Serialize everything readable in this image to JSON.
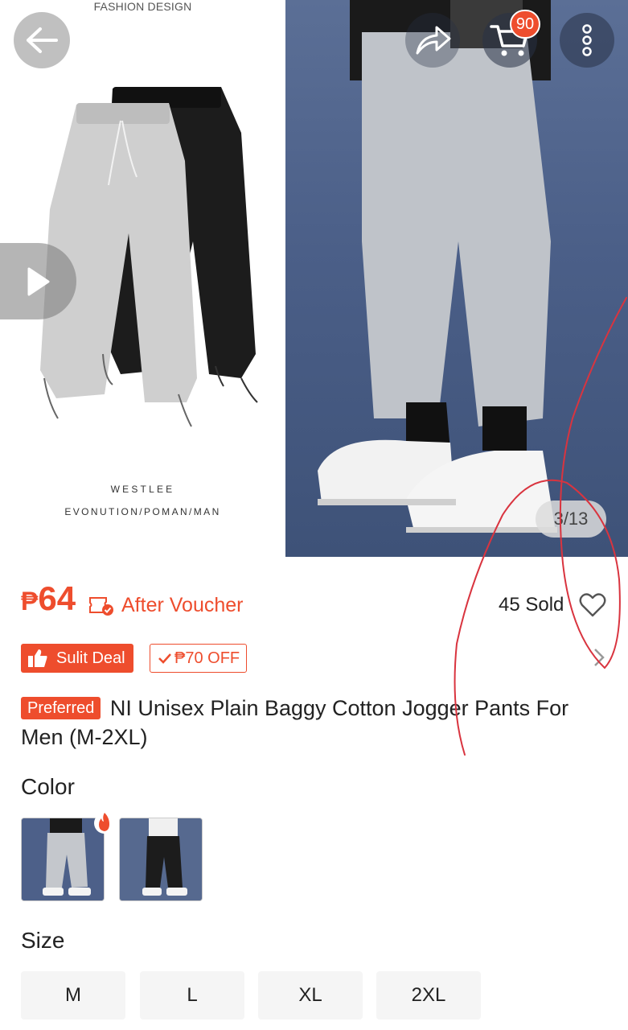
{
  "gallery": {
    "brand_top": "FASHION DESIGN",
    "brand_name": "WESTLEE",
    "brand_sub": "EVONUTION/POMAN/MAN",
    "image_counter": "3/13",
    "cart_count": "90",
    "icons": [
      "back-arrow-icon",
      "share-icon",
      "cart-icon",
      "more-icon",
      "play-icon"
    ]
  },
  "product": {
    "currency": "₱",
    "price": "64",
    "after_voucher": "After Voucher",
    "sold": "45 Sold",
    "deal_label": "Sulit Deal",
    "voucher_off": "₱70 OFF",
    "preferred_badge": "Preferred",
    "title": "NI Unisex Plain Baggy Cotton Jogger Pants For Men (M-2XL)"
  },
  "variations": {
    "color_label": "Color",
    "size_label": "Size",
    "sizes": [
      "M",
      "L",
      "XL",
      "2XL"
    ]
  },
  "colors": {
    "accent": "#ee4d2d",
    "annotation": "#d9343f"
  }
}
